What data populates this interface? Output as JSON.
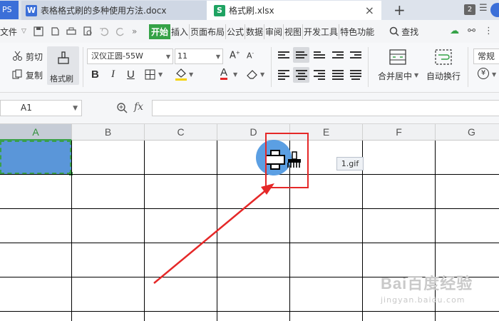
{
  "tabbar": {
    "app_label": "PS",
    "doc_tab": {
      "icon": "W",
      "title": "表格格式刷的多种使用方法.docx"
    },
    "xls_tab": {
      "icon": "S",
      "title": "格式刷.xlsx",
      "close": "×"
    },
    "add_tab": "+",
    "window_count": "2"
  },
  "menubar": {
    "file": "文件",
    "items": [
      "开始",
      "插入",
      "页面布局",
      "公式",
      "数据",
      "审阅",
      "视图",
      "开发工具",
      "特色功能"
    ],
    "active_item": "开始",
    "search": "查找"
  },
  "ribbon": {
    "cut": "剪切",
    "copy": "复制",
    "format_painter": "格式刷",
    "font_name": "汉仪正圆-55W",
    "font_size": "11",
    "bold": "B",
    "italic": "I",
    "underline": "U",
    "font_color_letter": "A",
    "merge_center": "合并居中",
    "wrap_text": "自动换行",
    "number_format": "常规",
    "currency": "¥"
  },
  "formulabar": {
    "cell_ref": "A1",
    "fx": "fx",
    "formula": ""
  },
  "grid": {
    "columns": [
      "A",
      "B",
      "C",
      "D",
      "E",
      "F",
      "G"
    ],
    "selected_column": "A"
  },
  "annotations": {
    "gif_tag": "1.gif",
    "arrow_color": "#e52828",
    "box_color": "#e52828"
  },
  "watermark": {
    "logo": "Bai百度经验",
    "url": "jingyan.baidu.com"
  },
  "colors": {
    "accent_green": "#35a247",
    "selection_fill": "#5a96d9",
    "tab_bg": "#dde3ec"
  }
}
